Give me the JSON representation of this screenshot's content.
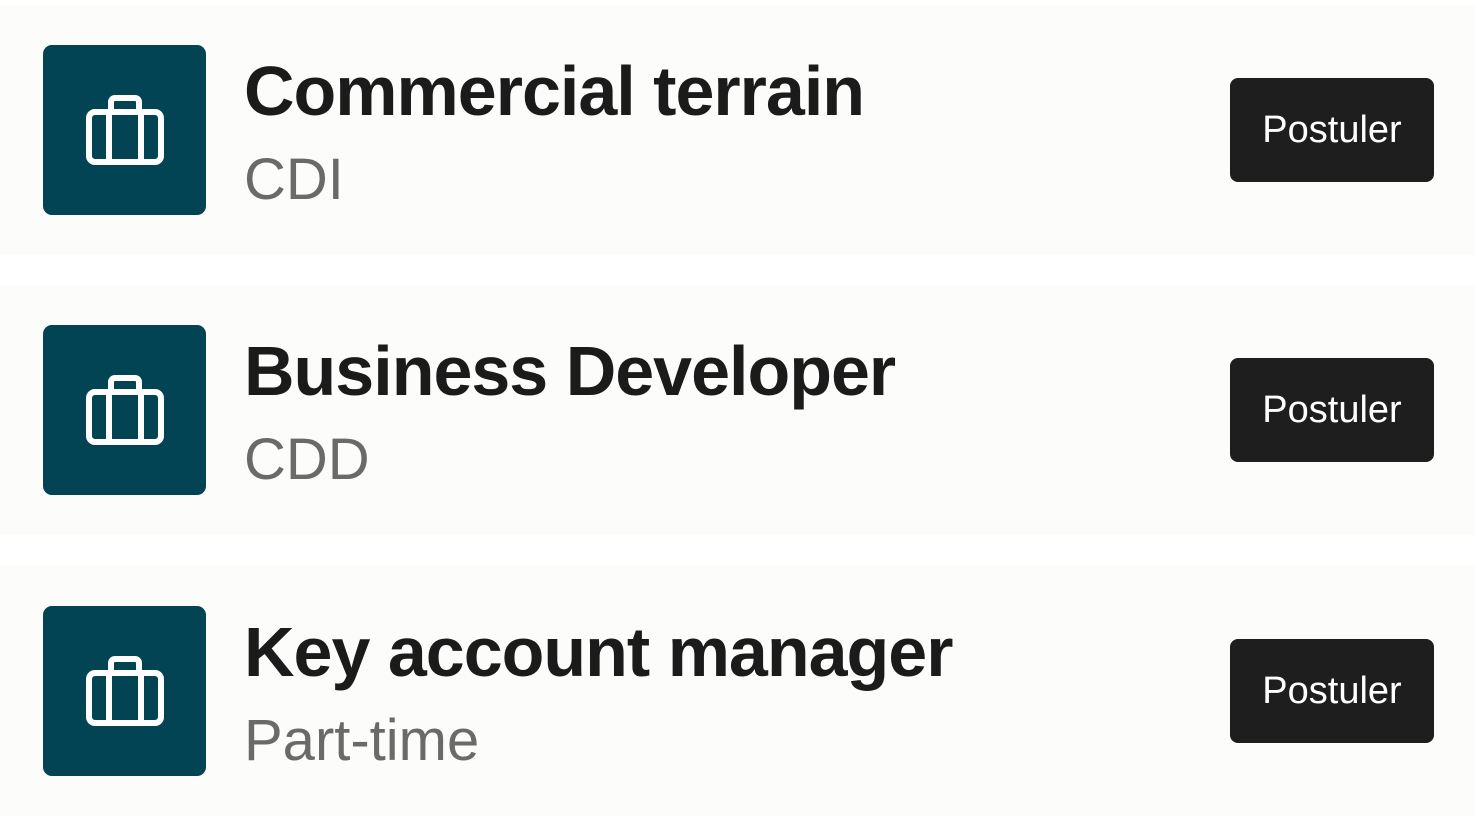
{
  "jobs": [
    {
      "title": "Commercial terrain",
      "contract_type": "CDI",
      "apply_label": "Postuler",
      "icon": "briefcase-icon"
    },
    {
      "title": "Business Developer",
      "contract_type": "CDD",
      "apply_label": "Postuler",
      "icon": "briefcase-icon"
    },
    {
      "title": "Key account manager",
      "contract_type": "Part-time",
      "apply_label": "Postuler",
      "icon": "briefcase-icon"
    }
  ],
  "colors": {
    "icon_tile": "#034454",
    "button": "#1e1e1e",
    "title": "#1b1b1b",
    "subtitle": "#6a6a6a",
    "card": "#fcfcfa"
  }
}
